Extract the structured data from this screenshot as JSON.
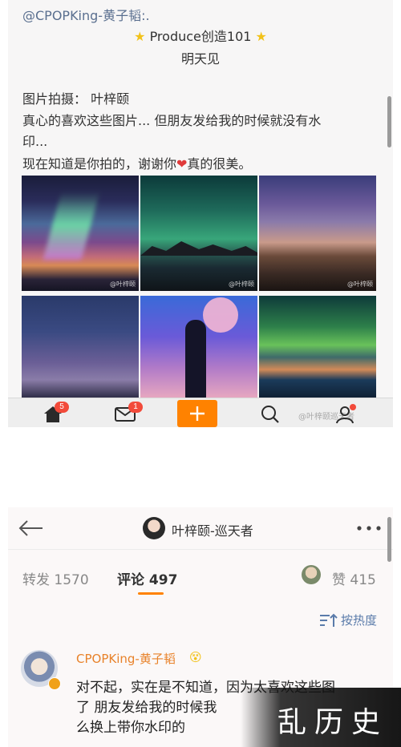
{
  "post": {
    "mention": "@CPOPKing-黄子韬:.",
    "line1": "Produce创造101",
    "line2": "明天见",
    "credit": "图片拍摄：  叶梓颐",
    "body1": "真心的喜欢这些图片... 但朋友发给我的时候就没有水",
    "body2": "印...",
    "body3_a": "现在知道是你拍的，谢谢你",
    "body3_b": "真的很美。",
    "heart": "❤",
    "star": "★",
    "watermark": "@叶梓颐",
    "photos": [
      {
        "name": "aurora-lake"
      },
      {
        "name": "aurora-mountains"
      },
      {
        "name": "milky-way-desert"
      },
      {
        "name": "milky-way-night"
      },
      {
        "name": "illustration-figure-planets"
      },
      {
        "name": "aurora-horizon"
      }
    ]
  },
  "tabbar": {
    "home_badge": "5",
    "msg_badge": "1",
    "watermark": "@叶梓颐巡天者",
    "icons": [
      "home-icon",
      "message-icon",
      "compose-icon",
      "search-icon",
      "profile-icon"
    ],
    "accent": "#ff8200"
  },
  "detail": {
    "title": "叶梓颐-巡天者",
    "more": "• • •",
    "repost_label": "转发 1570",
    "comment_label": "评论 497",
    "like_label": "赞 415",
    "sort_label": "按热度"
  },
  "comment": {
    "user": "CPOPKing-黄子韬",
    "emoji": "😵",
    "line1": "对不起，实在是不知道，因为太喜欢这些图",
    "line2": "了 朋友发给我的时候我",
    "line3": "么换上带你水印的"
  },
  "logo": {
    "text": "乱历史"
  },
  "colors": {
    "link": "#5a6f8f",
    "username": "#e8822a",
    "badge": "#f24a3a",
    "accent": "#ff8200"
  }
}
